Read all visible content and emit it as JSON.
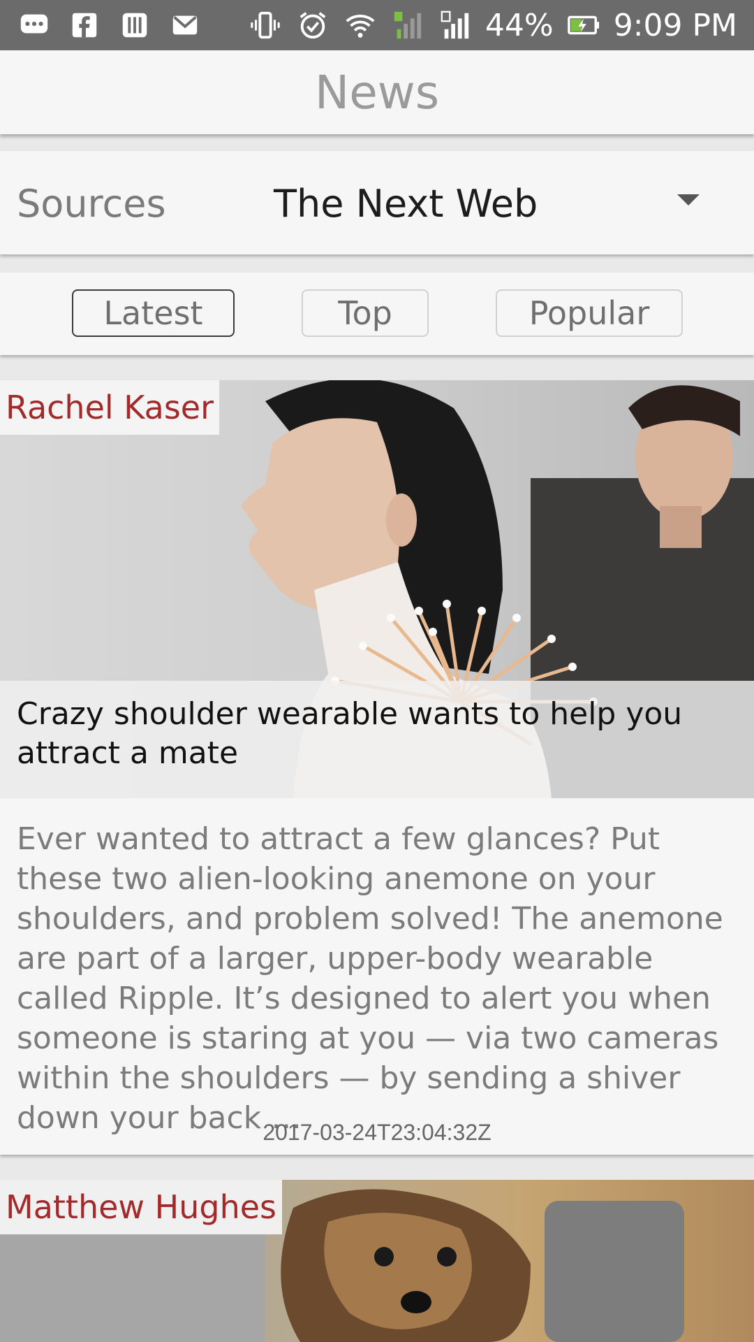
{
  "status_bar": {
    "battery": "44%",
    "time": "9:09 PM",
    "icons": [
      "message-icon",
      "facebook-icon",
      "app-icon",
      "gmail-icon",
      "vibrate-icon",
      "alarm-icon",
      "wifi-icon",
      "signal-sim1-icon",
      "signal-sim2-icon",
      "battery-charging-icon"
    ]
  },
  "app_bar": {
    "title": "News"
  },
  "sources": {
    "label": "Sources",
    "selected": "The Next Web"
  },
  "tabs": [
    {
      "label": "Latest",
      "active": true
    },
    {
      "label": "Top",
      "active": false
    },
    {
      "label": "Popular",
      "active": false
    }
  ],
  "articles": [
    {
      "author": "Rachel Kaser",
      "title": "Crazy shoulder wearable wants to help you attract a mate",
      "summary": "Ever wanted to attract a few glances? Put these two alien-looking anemone on your shoulders, and problem solved! The anemone are part of a larger, upper-body wearable called Ripple. It’s designed to alert you when someone is staring at you — via two cameras within the shoulders — by sending a shiver down your back …",
      "date": "2017-03-24T23:04:32Z"
    },
    {
      "author": "Matthew Hughes"
    }
  ],
  "colors": {
    "status_bar": "#6b6b6b",
    "author": "#a32a2a",
    "background": "#e9e9e9",
    "card": "#f6f6f6"
  }
}
